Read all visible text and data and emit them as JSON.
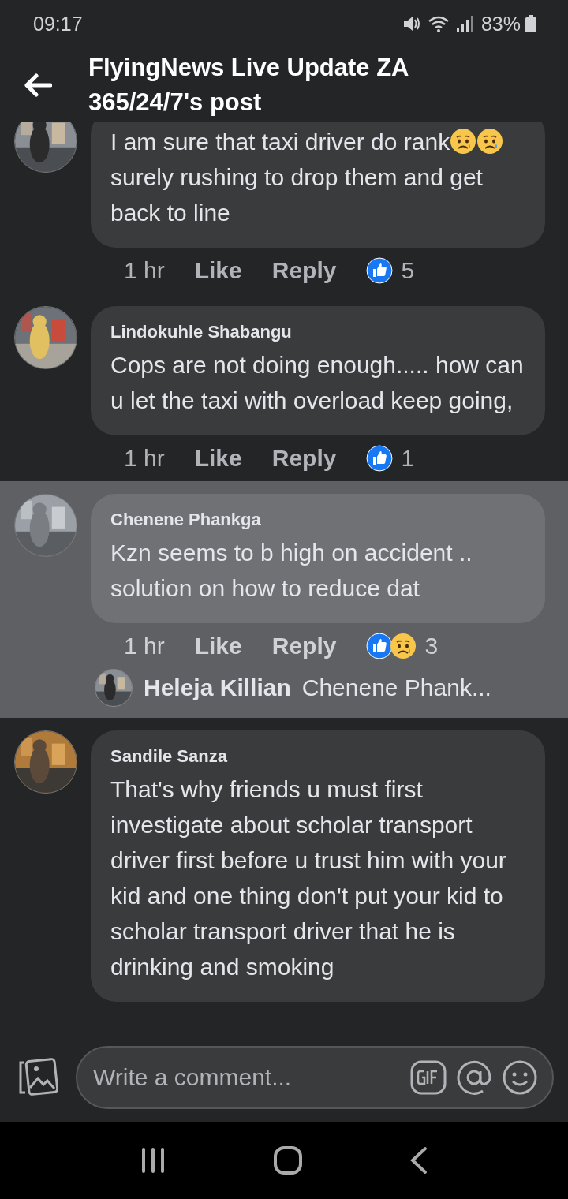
{
  "status_bar": {
    "time": "09:17",
    "battery": "83%"
  },
  "header": {
    "title": "FlyingNews Live Update ZA 365/24/7's post"
  },
  "comments": [
    {
      "highlighted": false,
      "segments": [
        {
          "kind": "text",
          "text": "I am sure that taxi driver do rank"
        },
        {
          "kind": "emoji"
        },
        {
          "kind": "emoji"
        },
        {
          "kind": "text",
          "text": " surely rushing to drop them and get back to line"
        }
      ],
      "time": "1 hr",
      "like": "Like",
      "reply": "Reply",
      "reactions": [
        {
          "kind": "like"
        }
      ],
      "reaction_count": "5"
    },
    {
      "highlighted": false,
      "name": "Lindokuhle Shabangu",
      "segments": [
        {
          "kind": "text",
          "text": "Cops are not doing enough..... how can u let the taxi with overload keep going,"
        }
      ],
      "time": "1 hr",
      "like": "Like",
      "reply": "Reply",
      "reactions": [
        {
          "kind": "like"
        }
      ],
      "reaction_count": "1"
    },
    {
      "highlighted": true,
      "name": "Chenene Phankga",
      "segments": [
        {
          "kind": "text",
          "text": "Kzn seems to b high on accident .. solution on how to reduce dat"
        }
      ],
      "time": "1 hr",
      "like": "Like",
      "reply": "Reply",
      "reactions": [
        {
          "kind": "like"
        },
        {
          "kind": "sad"
        }
      ],
      "reaction_count": "3",
      "reply_preview": {
        "name": "Heleja Killian",
        "text": "Chenene Phank..."
      }
    },
    {
      "highlighted": false,
      "name": "Sandile Sanza",
      "segments": [
        {
          "kind": "text",
          "text": "That's why friends u must first investigate about scholar transport driver first before u trust him with your kid and one thing don't put your kid to scholar transport driver that he is drinking and smoking"
        }
      ]
    }
  ],
  "composer": {
    "placeholder": "Write a comment..."
  }
}
